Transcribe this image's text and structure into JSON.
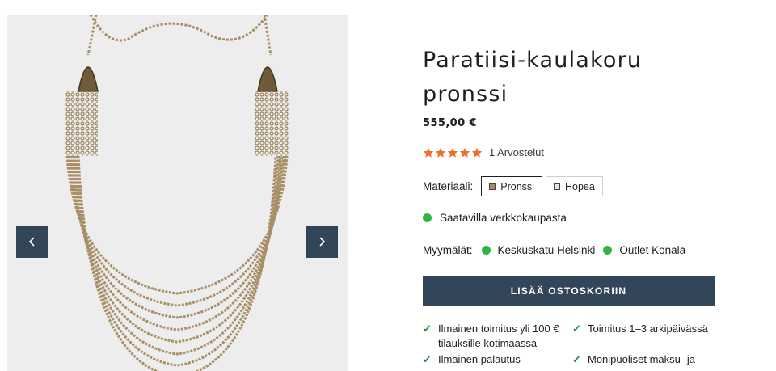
{
  "product": {
    "title": "Paratiisi-kaulakoru pronssi",
    "price": "555,00 €",
    "rating": {
      "stars": 5,
      "max": 5,
      "reviews_text": "1 Arvostelut",
      "star_color": "#e8712b"
    },
    "material": {
      "label": "Materiaali:",
      "options": [
        {
          "label": "Pronssi",
          "swatch_color": "#a98a5b",
          "selected": true
        },
        {
          "label": "Hopea",
          "swatch_color": "#e6e6e6",
          "selected": false
        }
      ]
    },
    "availability": {
      "text": "Saatavilla verkkokaupasta",
      "status_color": "#2fb543"
    },
    "stores": {
      "label": "Myymälät:",
      "items": [
        "Keskuskatu Helsinki",
        "Outlet Konala"
      ]
    },
    "add_to_cart_label": "LISÄÄ OSTOSKORIIN",
    "benefits": [
      "Ilmainen toimitus yli 100 € tilauksille kotimaassa",
      "Toimitus 1–3 arkipäivässä",
      "Ilmainen palautus",
      "Monipuoliset maksu- ja"
    ]
  },
  "gallery": {
    "prev_icon": "chevron-left-icon",
    "next_icon": "chevron-right-icon",
    "button_color": "#334559"
  }
}
